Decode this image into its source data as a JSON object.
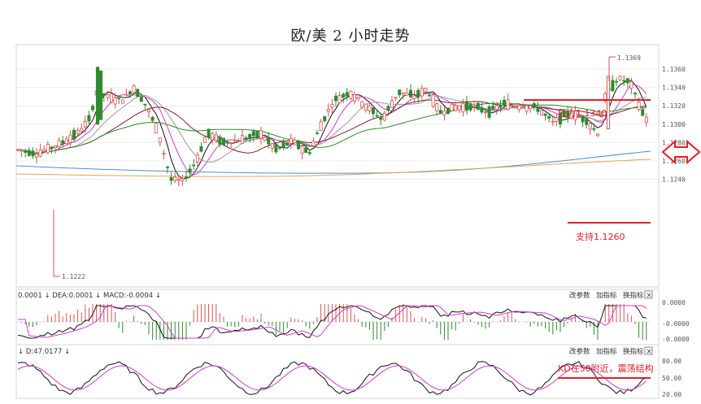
{
  "title": "欧/美 2 小时走势",
  "colors": {
    "up": "#d9534f",
    "down": "#2e8b2e",
    "resistance_line": "#e0202a",
    "support_line": "#e0202a",
    "ma_black": "#111111",
    "ma_magenta": "#d33ad3",
    "ma_gray": "#9a9a9a",
    "ma_darkred": "#7b1f2a",
    "ma_green": "#2e8b2e",
    "ma_blue": "#4a90c8",
    "ma_orange": "#e5a54a"
  },
  "price_panel": {
    "y_ticks": [
      "1.1360",
      "1.1340",
      "1.1320",
      "1.1300",
      "1.1280",
      "1.1260",
      "1.1240"
    ],
    "low_label": "1.1222",
    "high_label": "1.1369",
    "resistance_label": "压力1.1340",
    "support_label": "支持1.1260"
  },
  "macd_panel": {
    "header": "0.0001 ↓ DEA:0.0001 ↓ MACD:-0.0004 ↓",
    "buttons": [
      "改参数",
      "加指标",
      "换指标"
    ],
    "close_icon": "×",
    "y_ticks": [
      "0.0000",
      "-0.0000",
      "-0.0000"
    ]
  },
  "kd_panel": {
    "header": "↓ D:47.0177 ↓",
    "buttons": [
      "改参数",
      "加指标",
      "换指标"
    ],
    "close_icon": "×",
    "y_ticks": [
      "80.00",
      "50.00",
      "20.00"
    ],
    "annotation": "KD在50附近，震荡结构"
  },
  "chart_data": {
    "type": "candlestick",
    "title": "欧/美 2 小时走势",
    "ylim": [
      1.1222,
      1.1369
    ],
    "y_ticks": [
      1.136,
      1.134,
      1.132,
      1.13,
      1.128,
      1.126,
      1.124
    ],
    "resistance": 1.134,
    "support": 1.126,
    "annotated_low": 1.1222,
    "annotated_high": 1.1369,
    "note": "candle and indicator values are approximate readings from the figure"
  }
}
